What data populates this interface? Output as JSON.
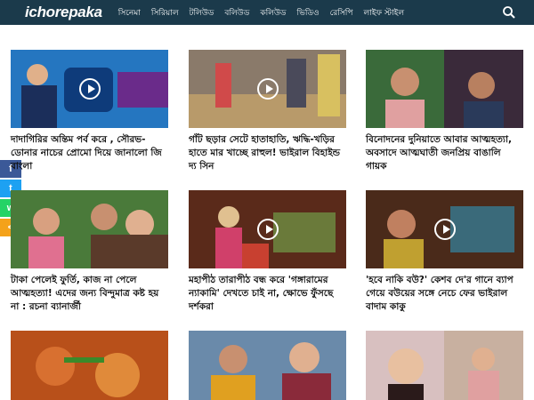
{
  "header": {
    "logo": "ichorepaka",
    "nav": [
      "সিনেমা",
      "সিরিয়াল",
      "টলিউড",
      "বলিউড",
      "কলিউড",
      "ভিডিও",
      "রেসিপি",
      "লাইফ স্টাইল"
    ]
  },
  "share": {
    "facebook": "f",
    "twitter": "t",
    "whatsapp": "w",
    "share": "<"
  },
  "articles": [
    {
      "title": "দাদাগিরির অন্তিম পর্ব করে , সৌরভ-ডোনার নাচের প্রোমো দিয়ে জানালো জি বাংলা",
      "video": true
    },
    {
      "title": "গাঁট ছড়ার সেটে হাতাহাতি, ঋদ্ধি-খড়ির হাতে মার খাচ্ছে রাহুল! ভাইরাল বিহাইন্ড দ্য সিন",
      "video": true
    },
    {
      "title": "বিনোদনের দুনিয়াতে আবার আত্মহত্যা, অবসাদে আত্মঘাতী জনপ্রিয় বাঙালি গায়ক",
      "video": false
    },
    {
      "title": "টাকা পেলেই ফুর্তি, কাজ না পেলে আত্মহত্যা! এদের জন্য বিন্দুমাত্র কষ্ট হয় না : রচনা ব্যানার্জী",
      "video": false
    },
    {
      "title": "মহাপীঠ তারাপীঠ বন্ধ করে 'গঙ্গারামের ন্যাকামি' দেখতে চাই না, ক্ষোভে ফুঁসছে দর্শকরা",
      "video": true
    },
    {
      "title": "'হবে নাকি বউ?' কেশব দে'র গানে ব্যাপ গেয়ে বউয়ের সঙ্গে নেচে ফের ভাইরাল বাদাম কাকু",
      "video": true
    },
    {
      "title": "",
      "video": false
    },
    {
      "title": "",
      "video": false
    },
    {
      "title": "",
      "video": false
    }
  ]
}
